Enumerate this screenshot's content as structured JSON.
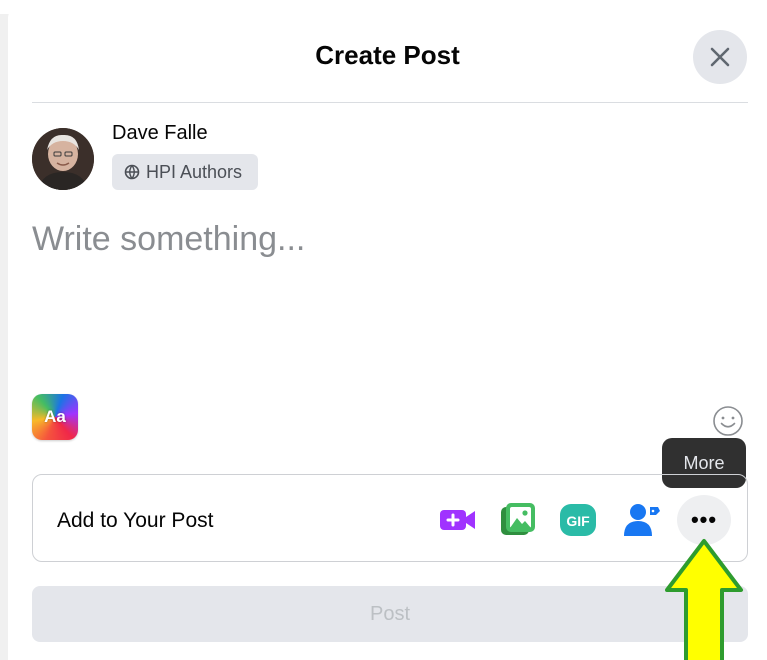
{
  "dialog": {
    "title": "Create Post",
    "close_icon": "close-icon"
  },
  "user": {
    "name": "Dave Falle",
    "audience_label": "HPI Authors",
    "audience_icon": "globe-icon"
  },
  "composer": {
    "placeholder": "Write something..."
  },
  "format": {
    "aa_label": "Aa"
  },
  "tooltip": {
    "text": "More"
  },
  "add_to_post": {
    "label": "Add to Your Post",
    "tools": [
      {
        "name": "live-video-icon",
        "color": "#a033ff"
      },
      {
        "name": "photo-video-icon",
        "color": "#45bd62"
      },
      {
        "name": "gif-icon",
        "color": "#2abba7"
      },
      {
        "name": "tag-people-icon",
        "color": "#1877f2"
      }
    ],
    "more_label": "•••"
  },
  "post_button": {
    "label": "Post"
  },
  "annotation": {
    "arrow_color": "#ffff00",
    "arrow_outline": "#2e9c2e"
  }
}
